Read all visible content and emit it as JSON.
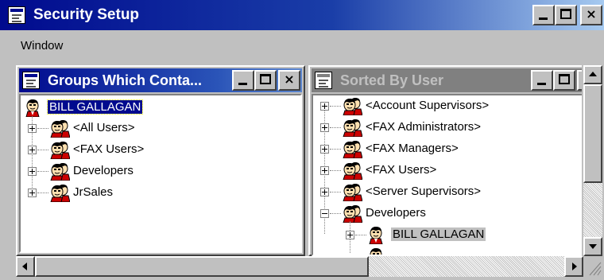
{
  "window": {
    "title": "Security Setup",
    "controls": {
      "minimize": "_",
      "maximize": "□",
      "close": "×"
    }
  },
  "menu": {
    "items": [
      {
        "label": "Window"
      }
    ]
  },
  "left_pane": {
    "title": "Groups Which Conta...",
    "root": {
      "label": "BILL GALLAGAN",
      "icon": "user-icon",
      "selected": true
    },
    "groups": [
      {
        "label": "<All Users>",
        "icon": "group-icon",
        "expanded": false
      },
      {
        "label": "<FAX Users>",
        "icon": "group-icon",
        "expanded": false
      },
      {
        "label": "Developers",
        "icon": "group-icon",
        "expanded": false
      },
      {
        "label": "JrSales",
        "icon": "group-icon",
        "expanded": false
      }
    ]
  },
  "right_pane": {
    "title": "Sorted By User",
    "groups": [
      {
        "label": "<Account Supervisors>",
        "icon": "group-icon",
        "expanded": false
      },
      {
        "label": "<FAX Administrators>",
        "icon": "group-icon",
        "expanded": false
      },
      {
        "label": "<FAX Managers>",
        "icon": "group-icon",
        "expanded": false
      },
      {
        "label": "<FAX Users>",
        "icon": "group-icon",
        "expanded": false
      },
      {
        "label": "<Server Supervisors>",
        "icon": "group-icon",
        "expanded": false
      },
      {
        "label": "Developers",
        "icon": "group-icon",
        "expanded": true
      }
    ],
    "children": [
      {
        "label": "BILL GALLAGAN",
        "icon": "user-icon",
        "highlighted": true
      }
    ]
  },
  "colors": {
    "active_title": "#000a8e",
    "inactive_title": "#808080",
    "face": "#c0c0c0",
    "selection": "#000a8e"
  }
}
